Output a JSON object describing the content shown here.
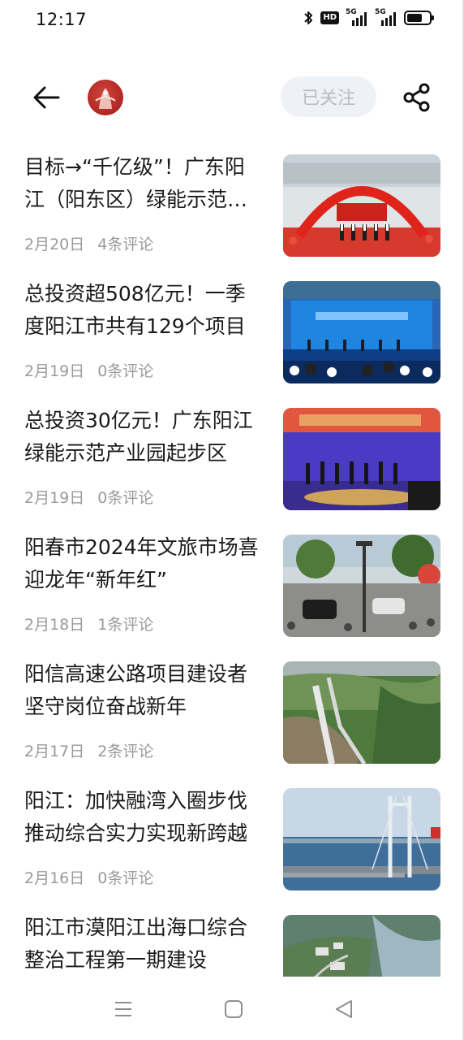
{
  "status_bar": {
    "time": "12:17",
    "hd_label": "HD",
    "network_1": "5G",
    "network_2": "5G",
    "battery_level": 0.7
  },
  "header": {
    "follow_label": "已关注",
    "icons": [
      "back-arrow-icon",
      "account-logo",
      "share-icon"
    ]
  },
  "articles": [
    {
      "title": "目标→“千亿级”！广东阳江（阳东区）绿能示范产业园",
      "date": "2月20日",
      "comments": "4条评论",
      "thumb": "groundbreaking-red-arch"
    },
    {
      "title": "总投资超508亿元！一季度阳江市共有129个项目",
      "date": "2月19日",
      "comments": "0条评论",
      "thumb": "blue-stage-ceremony"
    },
    {
      "title": "总投资30亿元！广东阳江绿能示范产业园起步区",
      "date": "2月19日",
      "comments": "0条评论",
      "thumb": "shovel-ceremony"
    },
    {
      "title": "阳春市2024年文旅市场喜迎龙年“新年红”",
      "date": "2月18日",
      "comments": "1条评论",
      "thumb": "street-crowd"
    },
    {
      "title": "阳信高速公路项目建设者坚守岗位奋战新年",
      "date": "2月17日",
      "comments": "2条评论",
      "thumb": "highway-aerial"
    },
    {
      "title": "阳江：加快融湾入圈步伐 推动综合实力实现新跨越",
      "date": "2月16日",
      "comments": "0条评论",
      "thumb": "bridge-port"
    },
    {
      "title": "阳江市漠阳江出海口综合整治工程第一期建设",
      "date": "",
      "comments": "",
      "thumb": "river-aerial"
    }
  ],
  "nav_bar": {
    "buttons": [
      "menu-icon",
      "home-icon",
      "back-triangle-icon"
    ]
  }
}
